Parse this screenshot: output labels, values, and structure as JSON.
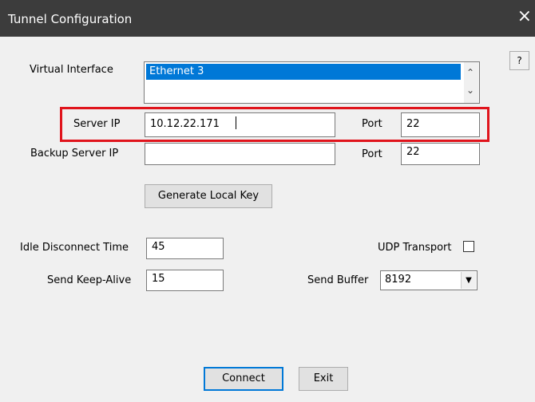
{
  "window": {
    "title": "Tunnel Configuration",
    "close_icon": "×",
    "help_label": "?"
  },
  "virtual_interface": {
    "label": "Virtual Interface",
    "selected": "Ethernet 3"
  },
  "server": {
    "ip_label": "Server IP",
    "ip_value": "10.12.22.171",
    "port_label": "Port",
    "port_value": "22"
  },
  "backup": {
    "ip_label": "Backup Server IP",
    "ip_value": "",
    "port_label": "Port",
    "port_value": "22"
  },
  "generate_key_label": "Generate Local Key",
  "idle": {
    "label": "Idle Disconnect Time",
    "value": "45"
  },
  "keepalive": {
    "label": "Send Keep-Alive",
    "value": "15"
  },
  "udp": {
    "label": "UDP Transport",
    "checked": false
  },
  "send_buffer": {
    "label": "Send Buffer",
    "value": "8192"
  },
  "buttons": {
    "connect": "Connect",
    "exit": "Exit"
  },
  "colors": {
    "titlebar": "#3c3c3c",
    "selection": "#0078d7",
    "highlight": "#e0141c"
  }
}
